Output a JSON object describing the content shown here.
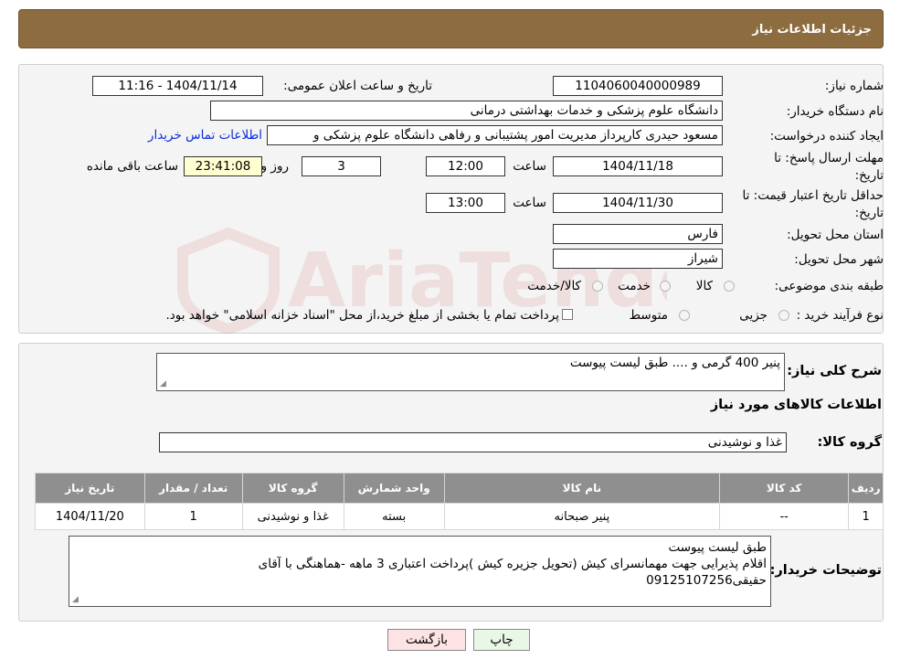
{
  "header": {
    "title": "جزئیات اطلاعات نیاز"
  },
  "watermark": "AriaTender.neT",
  "fields": {
    "need_number_label": "شماره نیاز:",
    "need_number": "1104060040000989",
    "announce_label": "تاریخ و ساعت اعلان عمومی:",
    "announce_value": "1404/11/14 - 11:16",
    "buyer_org_label": "نام دستگاه خریدار:",
    "buyer_org": "دانشگاه علوم پزشکی و خدمات بهداشتی درمانی",
    "requester_label": "ایجاد کننده درخواست:",
    "requester": "مسعود حیدری کارپرداز مدیریت امور پشتیبانی و رفاهی دانشگاه علوم پزشکی و",
    "contact_link": "اطلاعات تماس خریدار",
    "deadline_label_1": "مهلت ارسال پاسخ: تا",
    "deadline_label_2": "تاریخ:",
    "deadline_date": "1404/11/18",
    "hour_label": "ساعت",
    "deadline_time": "12:00",
    "days_value": "3",
    "days_label": "روز و",
    "remaining_time": "23:41:08",
    "remaining_label": "ساعت باقی مانده",
    "price_validity_label_1": "حداقل تاریخ اعتبار قیمت: تا",
    "price_validity_label_2": "تاریخ:",
    "price_validity_date": "1404/11/30",
    "price_validity_time": "13:00",
    "province_label": "استان محل تحویل:",
    "province": "فارس",
    "city_label": "شهر محل تحویل:",
    "city": "شیراز",
    "category_label": "طبقه بندی موضوعی:",
    "category_options": [
      "کالا",
      "خدمت",
      "کالا/خدمت"
    ],
    "process_label": "نوع فرآیند خرید :",
    "process_options": [
      "جزیی",
      "متوسط"
    ],
    "process_note": "پرداخت تمام یا بخشی از مبلغ خرید،از محل \"اسناد خزانه اسلامی\" خواهد بود."
  },
  "need_desc": {
    "label": "شرح کلی نیاز:",
    "value": "پنیر 400 گرمی و .... طبق لیست پیوست"
  },
  "goods_section_title": "اطلاعات کالاهای مورد نیاز",
  "goods_group": {
    "label": "گروه کالا:",
    "value": "غذا و نوشیدنی"
  },
  "table": {
    "headers": [
      "ردیف",
      "کد کالا",
      "نام کالا",
      "واحد شمارش",
      "گروه کالا",
      "تعداد / مقدار",
      "تاریخ نیاز"
    ],
    "rows": [
      [
        "1",
        "--",
        "پنیر صبحانه",
        "بسته",
        "غذا و نوشیدنی",
        "1",
        "1404/11/20"
      ]
    ]
  },
  "buyer_notes": {
    "label": "توضیحات خریدار:",
    "line1": "طبق لیست پیوست",
    "line2": "اقلام پذیرایی جهت مهمانسرای کیش (تحویل جزیره کیش )پرداخت اعتباری 3 ماهه -هماهنگی با آقای",
    "line3": "حقیقی09125107256"
  },
  "buttons": {
    "print": "چاپ",
    "back": "بازگشت"
  }
}
